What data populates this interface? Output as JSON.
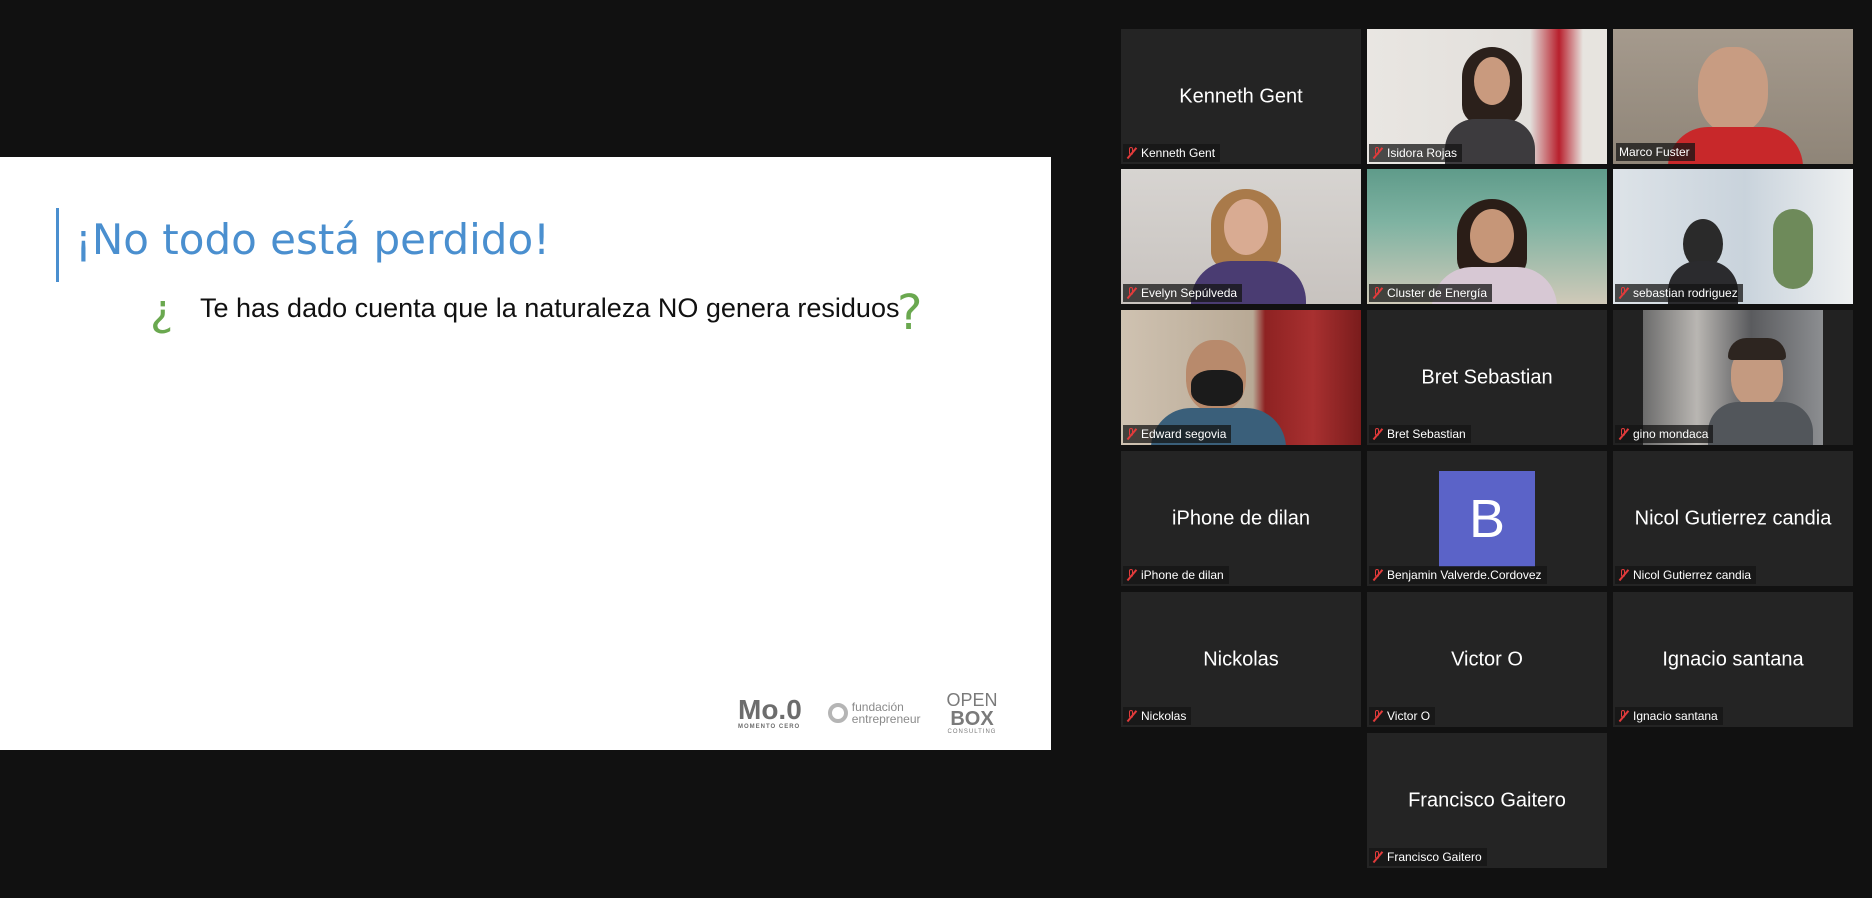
{
  "slide": {
    "title": "¡No todo está perdido!",
    "open_q": "¿",
    "bullet": "Te has dado cuenta que la naturaleza NO genera residuos",
    "close_q": "?",
    "logos": {
      "mo_main": "Mo.0",
      "mo_sub": "MOMENTO CERO",
      "fund_line1": "fundación",
      "fund_line2": "entrepreneur",
      "open_line1": "OPEN",
      "open_line2": "BOX",
      "open_line3": "CONSULTING"
    }
  },
  "participants": [
    {
      "name": "Kenneth Gent",
      "center": "Kenneth Gent"
    },
    {
      "name": "Isidora Rojas"
    },
    {
      "name": "Marco Fuster"
    },
    {
      "name": "Evelyn Sepúlveda"
    },
    {
      "name": "Cluster de Energía"
    },
    {
      "name": "sebastian rodriguez"
    },
    {
      "name": "Edward segovia"
    },
    {
      "name": "Bret Sebastian",
      "center": "Bret Sebastian"
    },
    {
      "name": "gino mondaca"
    },
    {
      "name": "iPhone de dilan",
      "center": "iPhone de dilan"
    },
    {
      "name": "Benjamin Valverde.Cordovez",
      "avatar": "B"
    },
    {
      "name": "Nicol Gutierrez candia",
      "center": "Nicol Gutierrez candia"
    },
    {
      "name": "Nickolas",
      "center": "Nickolas"
    },
    {
      "name": "Victor O",
      "center": "Victor O"
    },
    {
      "name": "Ignacio santana",
      "center": "Ignacio santana"
    },
    {
      "name": "Francisco Gaitero",
      "center": "Francisco Gaitero"
    }
  ],
  "colors": {
    "title_blue": "#4a8fcf",
    "question_green": "#6aa84f",
    "active_speaker": "#d9e07a",
    "avatar_purple": "#5b63c8",
    "muted_red": "#e23b3b"
  },
  "icons": {
    "muted": "muted-mic-icon"
  }
}
